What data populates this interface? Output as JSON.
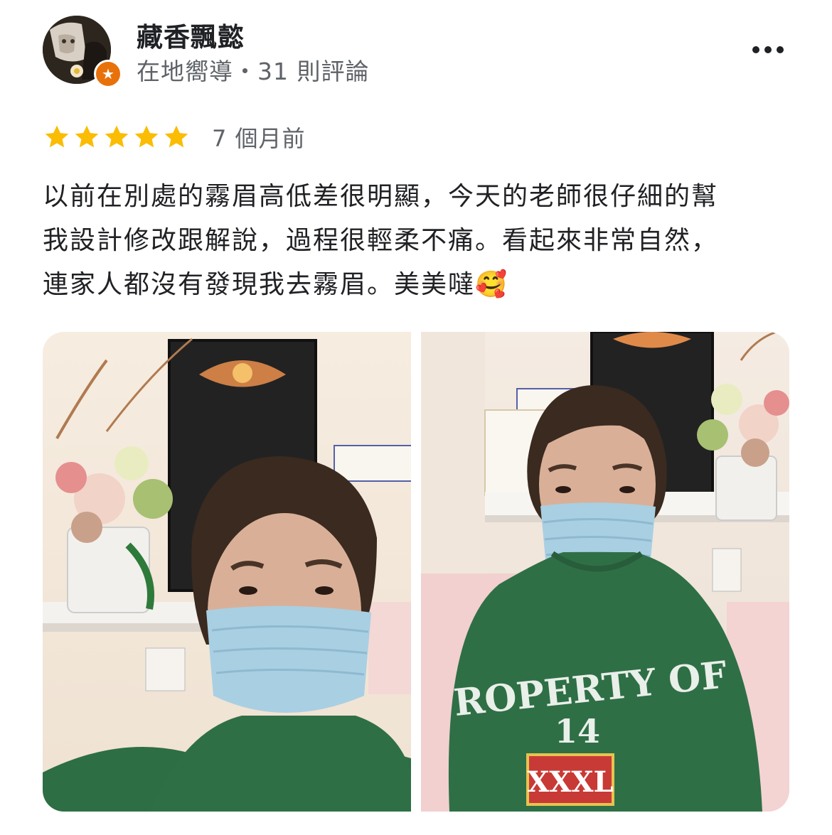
{
  "reviewer": {
    "name": "藏香飄懿",
    "meta": "在地嚮導・31 則評論",
    "badge_icon": "star-badge-icon",
    "badge_color": "#e8710a"
  },
  "review": {
    "rating": 5,
    "rating_max": 5,
    "star_color": "#fbbc04",
    "date": "7 個月前",
    "lines": [
      "以前在別處的霧眉高低差很明顯，今天的老師很仔細的幫",
      "我設計修改跟解說，過程很輕柔不痛。看起來非常自然，",
      "連家人都沒有發現我去霧眉。美美噠🥰"
    ]
  },
  "photos": {
    "photo_2_shirt_text": {
      "line1": "ROPERTY OF",
      "line2": "14",
      "line3": "XXXL"
    }
  },
  "menu": {
    "icon": "more-horizontal-icon"
  }
}
